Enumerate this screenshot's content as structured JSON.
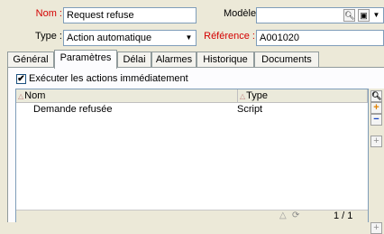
{
  "form": {
    "nom_label": "Nom :",
    "nom_value": "Request refuse",
    "modele_label": "Modèle :",
    "modele_value": "",
    "type_label": "Type :",
    "type_value": "Action automatique",
    "reference_label": "Référence :",
    "reference_value": "A001020"
  },
  "tabs": [
    {
      "label": "Général",
      "active": false
    },
    {
      "label": "Paramètres",
      "active": true
    },
    {
      "label": "Délai",
      "active": false
    },
    {
      "label": "Alarmes",
      "active": false
    },
    {
      "label": "Historique",
      "active": false
    },
    {
      "label": "Documents",
      "active": false
    }
  ],
  "options": {
    "execute_label": "Exécuter les actions immédiatement",
    "execute_checked": true
  },
  "list": {
    "columns": [
      "Nom",
      "Type"
    ],
    "rows": [
      {
        "nom": "Demande refusée",
        "type": "Script"
      }
    ]
  },
  "status": {
    "page": "1 / 1"
  },
  "colors": {
    "accent_red": "#d40000",
    "window_bg": "#ece9d8"
  }
}
